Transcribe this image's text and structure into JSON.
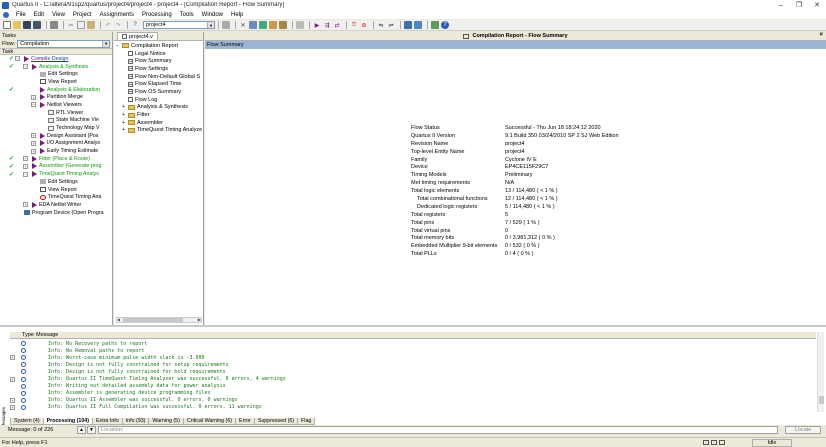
{
  "window": {
    "title": "Quartus II - C:/altera/91sp2/quartus/project4/project4 - project4 - [Compilation Report - Flow Summary]",
    "buttons": {
      "minimize": "–",
      "restore": "❐",
      "close": "✕"
    }
  },
  "menu": [
    "File",
    "Edit",
    "View",
    "Project",
    "Assignments",
    "Processing",
    "Tools",
    "Window",
    "Help"
  ],
  "toolbar": {
    "entity_combo": "project4"
  },
  "tasks_panel": {
    "title": "Tasks",
    "flow_label": "Flow:",
    "flow_value": "Compilation",
    "task_header": "Task",
    "items": [
      {
        "label": "Compile Design",
        "color": "blue",
        "done": true,
        "expander": "⊟",
        "indent": 0
      },
      {
        "label": "Analysis & Synthesis",
        "color": "green",
        "done": true,
        "expander": "⊟",
        "indent": 1
      },
      {
        "label": "Edit Settings",
        "color": "black",
        "done": false,
        "expander": "",
        "indent": 2
      },
      {
        "label": "View Report",
        "color": "black",
        "done": false,
        "expander": "",
        "indent": 2
      },
      {
        "label": "Analysis & Elaboration",
        "color": "green",
        "done": true,
        "expander": "",
        "indent": 2
      },
      {
        "label": "Partition Merge",
        "color": "black",
        "done": false,
        "expander": "⊞",
        "indent": 2
      },
      {
        "label": "Netlist Viewers",
        "color": "black",
        "done": false,
        "expander": "⊟",
        "indent": 2
      },
      {
        "label": "RTL Viewer",
        "color": "black",
        "done": false,
        "expander": "",
        "indent": 3
      },
      {
        "label": "State Machine Vie",
        "color": "black",
        "done": false,
        "expander": "",
        "indent": 3
      },
      {
        "label": "Technology Map V",
        "color": "black",
        "done": false,
        "expander": "",
        "indent": 3
      },
      {
        "label": "Design Assistant (Pos",
        "color": "black",
        "done": false,
        "expander": "⊞",
        "indent": 2
      },
      {
        "label": "I/O Assignment Analys",
        "color": "black",
        "done": false,
        "expander": "⊞",
        "indent": 2
      },
      {
        "label": "Early Timing Estimate",
        "color": "black",
        "done": false,
        "expander": "⊞",
        "indent": 2
      },
      {
        "label": "Fitter (Place & Route)",
        "color": "green",
        "done": true,
        "expander": "⊞",
        "indent": 1
      },
      {
        "label": "Assembler (Generate prog",
        "color": "green",
        "done": true,
        "expander": "⊞",
        "indent": 1
      },
      {
        "label": "TimeQuest Timing Analys",
        "color": "green",
        "done": true,
        "expander": "⊟",
        "indent": 1
      },
      {
        "label": "Edit Settings",
        "color": "black",
        "done": false,
        "expander": "",
        "indent": 2
      },
      {
        "label": "View Report",
        "color": "black",
        "done": false,
        "expander": "",
        "indent": 2
      },
      {
        "label": "TimeQuest Timing Ana",
        "color": "black",
        "done": false,
        "expander": "",
        "indent": 2
      },
      {
        "label": "EDA Netlist Writer",
        "color": "black",
        "done": false,
        "expander": "⊞",
        "indent": 1
      },
      {
        "label": "Program Device (Open Progra",
        "color": "black",
        "done": false,
        "expander": "",
        "indent": 0
      }
    ]
  },
  "report_tree": {
    "tab_label": "project4.v",
    "items": [
      {
        "label": "Compilation Report",
        "icon": "folder",
        "indent": 0,
        "expander": "⊟"
      },
      {
        "label": "Legal Notice",
        "icon": "doc",
        "indent": 1,
        "expander": ""
      },
      {
        "label": "Flow Summary",
        "icon": "grid",
        "indent": 1,
        "expander": ""
      },
      {
        "label": "Flow Settings",
        "icon": "grid",
        "indent": 1,
        "expander": ""
      },
      {
        "label": "Flow Non-Default Global S",
        "icon": "grid",
        "indent": 1,
        "expander": ""
      },
      {
        "label": "Flow Elapsed Time",
        "icon": "grid",
        "indent": 1,
        "expander": ""
      },
      {
        "label": "Flow OS Summary",
        "icon": "grid",
        "indent": 1,
        "expander": ""
      },
      {
        "label": "Flow Log",
        "icon": "doc",
        "indent": 1,
        "expander": ""
      },
      {
        "label": "Analysis & Synthesis",
        "icon": "folder",
        "indent": 1,
        "expander": "⊞"
      },
      {
        "label": "Fitter",
        "icon": "folder",
        "indent": 1,
        "expander": "⊞"
      },
      {
        "label": "Assembler",
        "icon": "folder",
        "indent": 1,
        "expander": "⊞"
      },
      {
        "label": "TimeQuest Timing Analyze",
        "icon": "folder",
        "indent": 1,
        "expander": "⊞"
      }
    ]
  },
  "report": {
    "title": "Compilation Report - Flow Summary",
    "section": "Flow Summary",
    "rows": [
      {
        "key": "Flow Status",
        "value": "Successful - Thu Jun 18 18:24:12 2020",
        "indent": 0
      },
      {
        "key": "Quartus II Version",
        "value": "9.1 Build 350 03/24/2010 SP 2 SJ Web Edition",
        "indent": 0
      },
      {
        "key": "Revision Name",
        "value": "project4",
        "indent": 0
      },
      {
        "key": "Top-level Entity Name",
        "value": "project4",
        "indent": 0
      },
      {
        "key": "Family",
        "value": "Cyclone IV E",
        "indent": 0
      },
      {
        "key": "Device",
        "value": "EP4CE115F29C7",
        "indent": 0
      },
      {
        "key": "Timing Models",
        "value": "Preliminary",
        "indent": 0
      },
      {
        "key": "Met timing requirements",
        "value": "N/A",
        "indent": 0
      },
      {
        "key": "Total logic elements",
        "value": "13 / 114,480 ( < 1 % )",
        "indent": 0
      },
      {
        "key": "Total combinational functions",
        "value": "12 / 114,480 ( < 1 % )",
        "indent": 1
      },
      {
        "key": "Dedicated logic registers",
        "value": "5 / 114,480 ( < 1 % )",
        "indent": 1
      },
      {
        "key": "Total registers",
        "value": "5",
        "indent": 0
      },
      {
        "key": "Total pins",
        "value": "7 / 529 ( 1 % )",
        "indent": 0
      },
      {
        "key": "Total virtual pins",
        "value": "0",
        "indent": 0
      },
      {
        "key": "Total memory bits",
        "value": "0 / 3,981,312 ( 0 % )",
        "indent": 0
      },
      {
        "key": "Embedded Multiplier 9-bit elements",
        "value": "0 / 532 ( 0 % )",
        "indent": 0
      },
      {
        "key": "Total PLLs",
        "value": "0 / 4 ( 0 % )",
        "indent": 0
      }
    ]
  },
  "messages": {
    "col_type": "Type",
    "col_message": "Message",
    "rows": [
      {
        "text": "Info: No Recovery paths to report",
        "expandable": false
      },
      {
        "text": "Info: No Removal paths to report",
        "expandable": false
      },
      {
        "text": "Info: Worst-case minimum pulse width slack is -3.000",
        "expandable": true
      },
      {
        "text": "Info: Design is not fully constrained for setup requirements",
        "expandable": false
      },
      {
        "text": "Info: Design is not fully constrained for hold requirements",
        "expandable": false
      },
      {
        "text": "Info: Quartus II TimeQuest Timing Analyzer was successful. 0 errors, 4 warnings",
        "expandable": true
      },
      {
        "text": "Info: Writing out detailed assembly data for power analysis",
        "expandable": false
      },
      {
        "text": "Info: Assembler is generating device programming files",
        "expandable": false
      },
      {
        "text": "Info: Quartus II Assembler was successful. 0 errors, 0 warnings",
        "expandable": true
      },
      {
        "text": "Info: Quartus II Full Compilation was successful. 0 errors, 11 warnings",
        "expandable": true
      }
    ],
    "tabs": [
      {
        "label": "System (4)",
        "active": false
      },
      {
        "label": "Processing (104)",
        "active": true
      },
      {
        "label": "Extra Info",
        "active": false
      },
      {
        "label": "Info (93)",
        "active": false
      },
      {
        "label": "Warning (5)",
        "active": false
      },
      {
        "label": "Critical Warning (6)",
        "active": false
      },
      {
        "label": "Error",
        "active": false
      },
      {
        "label": "Suppressed (6)",
        "active": false
      },
      {
        "label": "Flag",
        "active": false
      }
    ],
    "side_label": "Messages",
    "count_label": "Message: 0 of 226",
    "location_placeholder": "Location:",
    "locate_button": "Locate"
  },
  "statusbar": {
    "help": "For Help, press F1",
    "state": "Idle"
  }
}
